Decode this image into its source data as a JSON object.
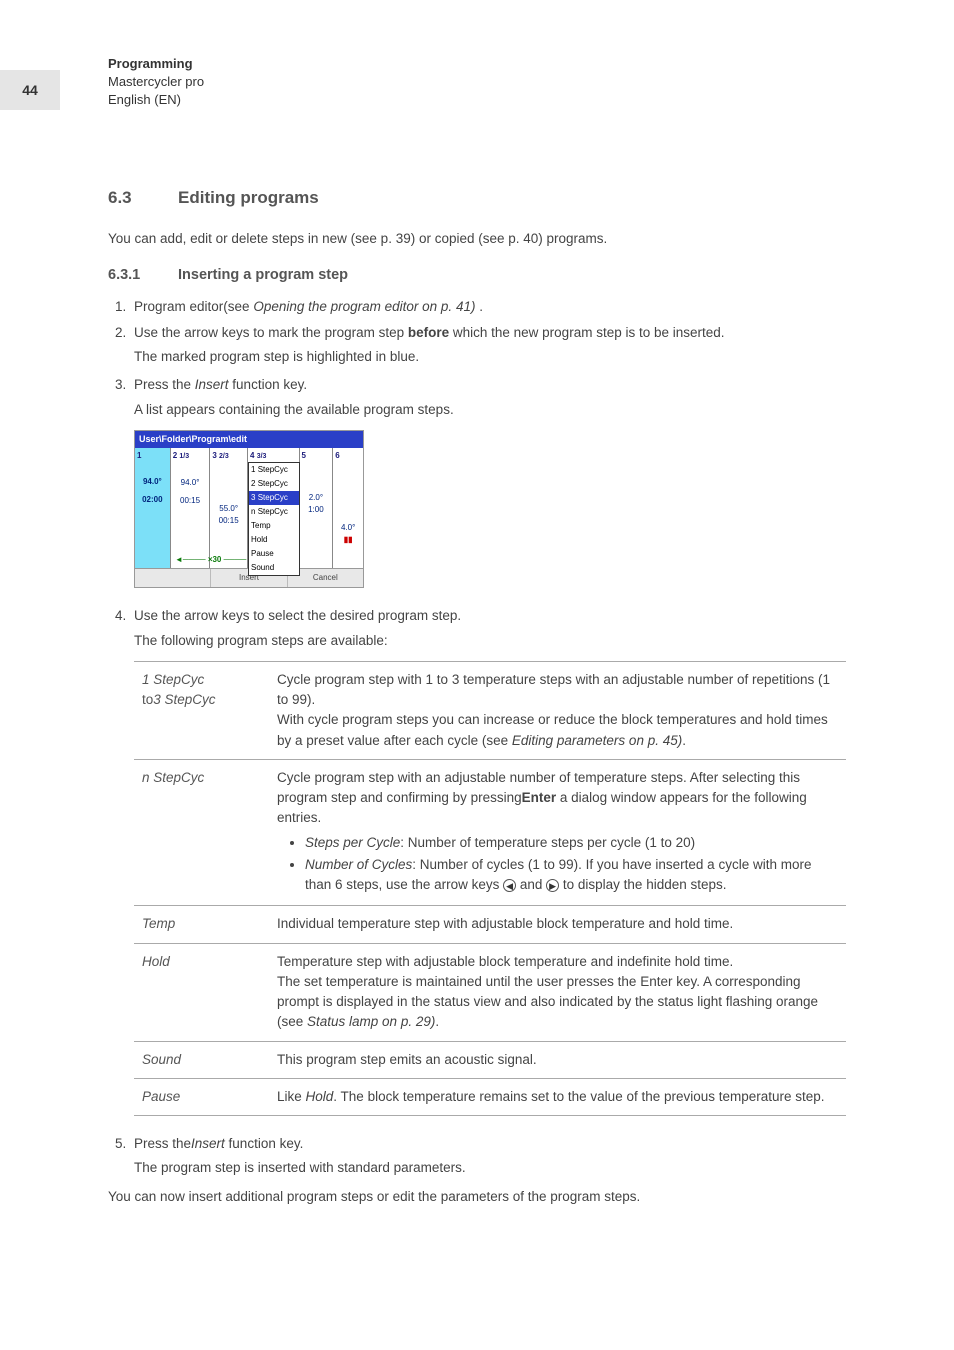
{
  "page_number": "44",
  "header": {
    "title": "Programming",
    "product": "Mastercycler pro",
    "language": "English (EN)"
  },
  "section": {
    "number": "6.3",
    "title": "Editing programs",
    "intro": "You can add, edit or delete steps in new (see p. 39) or copied (see p. 40) programs."
  },
  "subsection": {
    "number": "6.3.1",
    "title": "Inserting a program step"
  },
  "steps": {
    "s1_prefix": "Program editor(see ",
    "s1_ref": "Opening the program editor on p. 41)",
    "s1_suffix": " .",
    "s2_prefix": "Use the arrow keys to mark the program step ",
    "s2_bold": "before",
    "s2_suffix": " which the new program step is to be inserted.",
    "s2_sub": "The marked program step is highlighted in blue.",
    "s3_prefix": "Press the ",
    "s3_ref": "Insert",
    "s3_suffix": " function key.",
    "s3_sub": "A list appears containing the available program steps.",
    "s4": "Use the arrow keys to select the desired program step.",
    "s4_sub": "The following program steps are available:",
    "s5_prefix": "Press the",
    "s5_ref": "Insert",
    "s5_suffix": " function key.",
    "s5_sub": "The program step is inserted with standard parameters."
  },
  "closing": "You can now insert additional program steps or edit the parameters of the program steps.",
  "screenshot": {
    "titlebar": "User\\Folder\\Program\\edit",
    "col1_num": "1",
    "col1_temp": "94.0°",
    "col1_time": "02:00",
    "col2_num": "2",
    "col2_frac": "1/3",
    "col2_temp": "94.0°",
    "col2_time": "00:15",
    "col3_num": "3",
    "col3_frac": "2/3",
    "col3_temp": "55.0°",
    "col3_time": "00:15",
    "col4_num": "4",
    "col4_frac": "3/3",
    "col5_num": "5",
    "col5_temp": "2.0°",
    "col5_time": "1:00",
    "col6_num": "6",
    "col6_temp": "4.0°",
    "menu": [
      "1 StepCyc",
      "2 StepCyc",
      "3 StepCyc",
      "n StepCyc",
      "Temp",
      "Hold",
      "Pause",
      "Sound"
    ],
    "menu_selected_index": 2,
    "cycle_label": "×30",
    "footer_left": "",
    "footer_mid": "Insert",
    "footer_right": "Cancel"
  },
  "defs": {
    "row1_term1": "1 StepCyc",
    "row1_term2_prefix": "to",
    "row1_term2": "3 StepCyc",
    "row1_desc1": "Cycle program step with 1 to 3 temperature steps with an adjustable number of repetitions (1 to 99).",
    "row1_desc2_prefix": "With cycle program steps you can increase or reduce the block temperatures and hold times by a preset value after each cycle (see ",
    "row1_desc2_ref": "Editing parameters on p. 45)",
    "row1_desc2_suffix": ".",
    "row2_term": "n StepCyc",
    "row2_desc_prefix": "Cycle program step with an adjustable number of temperature steps. After selecting this program step and confirming by pressing",
    "row2_desc_bold": "Enter",
    "row2_desc_suffix": " a dialog window appears for the following entries.",
    "row2_b1_label": "Steps per Cycle",
    "row2_b1_text": ": Number of temperature steps per cycle (1 to 20)",
    "row2_b2_label": "Number of Cycles",
    "row2_b2_text_a": ": Number of cycles (1 to 99). If you have inserted a cycle with more than 6 steps, use the arrow keys ",
    "row2_b2_text_b": " and ",
    "row2_b2_text_c": " to display the hidden steps.",
    "row3_term": "Temp",
    "row3_desc": "Individual temperature step with adjustable block temperature and hold time.",
    "row4_term": "Hold",
    "row4_desc_a": "Temperature step with adjustable block temperature and indefinite hold time.",
    "row4_desc_b": "The set temperature is maintained until the user presses the Enter key. A corresponding prompt is displayed in the status view and also indicated by the status light flashing orange (see ",
    "row4_desc_ref": "Status lamp on p. 29)",
    "row4_desc_suffix": ".",
    "row5_term": "Sound",
    "row5_desc": "This program step emits an acoustic signal.",
    "row6_term": "Pause",
    "row6_desc_prefix": "Like ",
    "row6_desc_ref": "Hold",
    "row6_desc_suffix": ". The block temperature remains set to the value of the previous temperature step."
  }
}
